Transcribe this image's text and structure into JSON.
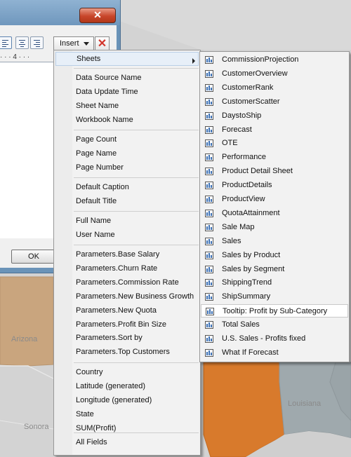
{
  "map": {
    "labels": {
      "arizona": "Arizona",
      "sonora": "Sonora",
      "louisiana": "Louisiana"
    }
  },
  "dialog": {
    "close_label": "✕",
    "ruler_text": "· · · 4 · · ·",
    "ok_label": "OK"
  },
  "toolbar": {
    "insert_label": "Insert",
    "delete_label": "✕"
  },
  "insert_menu": {
    "sheets_label": "Sheets",
    "groups": [
      [
        "Data Source Name",
        "Data Update Time",
        "Sheet Name",
        "Workbook Name"
      ],
      [
        "Page Count",
        "Page Name",
        "Page Number"
      ],
      [
        "Default Caption",
        "Default Title"
      ],
      [
        "Full Name",
        "User Name"
      ],
      [
        "Parameters.Base Salary",
        "Parameters.Churn Rate",
        "Parameters.Commission Rate",
        "Parameters.New Business Growth",
        "Parameters.New Quota",
        "Parameters.Profit Bin Size",
        "Parameters.Sort by",
        "Parameters.Top Customers"
      ],
      [
        "Country",
        "Latitude (generated)",
        "Longitude (generated)",
        "State",
        "SUM(Profit)"
      ],
      [
        "All Fields"
      ]
    ]
  },
  "sheets_menu": {
    "items": [
      "CommissionProjection",
      "CustomerOverview",
      "CustomerRank",
      "CustomerScatter",
      "DaystoShip",
      "Forecast",
      "OTE",
      "Performance",
      "Product Detail Sheet",
      "ProductDetails",
      "ProductView",
      "QuotaAttainment",
      "Sale Map",
      "Sales",
      "Sales by Product",
      "Sales by Segment",
      "ShippingTrend",
      "ShipSummary",
      "Tooltip: Profit by Sub-Category",
      "Total Sales",
      "U.S. Sales - Profits fixed",
      "What If Forecast"
    ],
    "highlighted_index": 18
  },
  "colors": {
    "arizona": "#c9a57e",
    "texas": "#d87a2c",
    "louisiana": "#9fa9ad",
    "dialog_frame": "#6a93b8"
  }
}
